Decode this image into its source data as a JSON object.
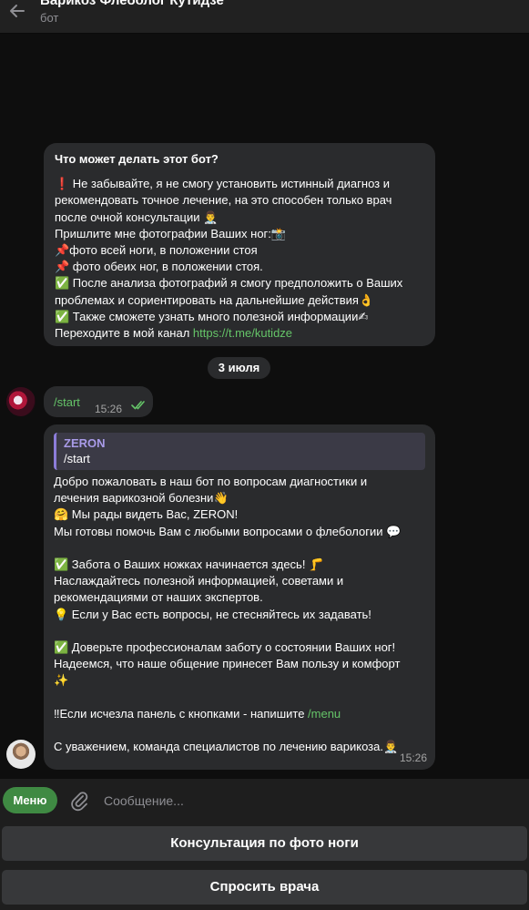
{
  "header": {
    "title": "Варикоз Флеболог Кутидзе",
    "subtitle": "бот",
    "back_icon": "arrow-left-icon"
  },
  "intro": {
    "heading": "Что может делать этот бот?",
    "lines": [
      "❗ Не забывайте, я не смогу установить истинный диагноз и",
      "рекомендовать точное лечение, на это способен только врач",
      "после очной консультации 👨‍⚕️",
      "Пришлите мне фотографии Ваших ног:📸",
      "📌фото всей ноги, в положении стоя",
      "📌 фото обеих ног, в положении стоя.",
      "✅ После анализа фотографий я смогу предположить о Ваших",
      "проблемах и  сориентировать на дальнейшие действия👌",
      "✅ Также сможете узнать много полезной информации✍"
    ],
    "channel_prefix": "Переходите в мой канал ",
    "channel_link": "https://t.me/kutidze"
  },
  "date_label": "3 июля",
  "outgoing": {
    "text": "/start",
    "time": "15:26",
    "status_icon": "double-check-icon"
  },
  "reply": {
    "quote_name": "ZERON",
    "quote_text": "/start",
    "lines": [
      "Добро пожаловать в наш бот по вопросам диагностики и",
      "лечения варикозной болезни👋",
      "🤗 Мы рады видеть Вас, ZERON!",
      "Мы готовы помочь Вам с любыми вопросами о флебологии 💬",
      "",
      "✅ Забота о Ваших ножках начинается здесь! 🦵",
      "Наслаждайтесь полезной информацией, советами и",
      "рекомендациями от наших экспертов.",
      "💡 Если у Вас есть вопросы, не стесняйтесь их задавать!",
      "",
      "✅ Доверьте профессионалам заботу о состоянии Ваших ног!",
      "Надеемся, что наше общение принесет Вам пользу и комфорт",
      "✨",
      "",
      "‼Если исчезла панель с кнопками - напишите /menu",
      "",
      "С уважением, команда специалистов по лечению варикоза.👨‍⚕️"
    ],
    "time": "15:26"
  },
  "composer": {
    "menu_label": "Меню",
    "attach_icon": "paperclip-icon",
    "placeholder": "Сообщение..."
  },
  "keyboard": {
    "buttons": [
      "Консультация по фото ноги",
      "Спросить врача"
    ]
  }
}
